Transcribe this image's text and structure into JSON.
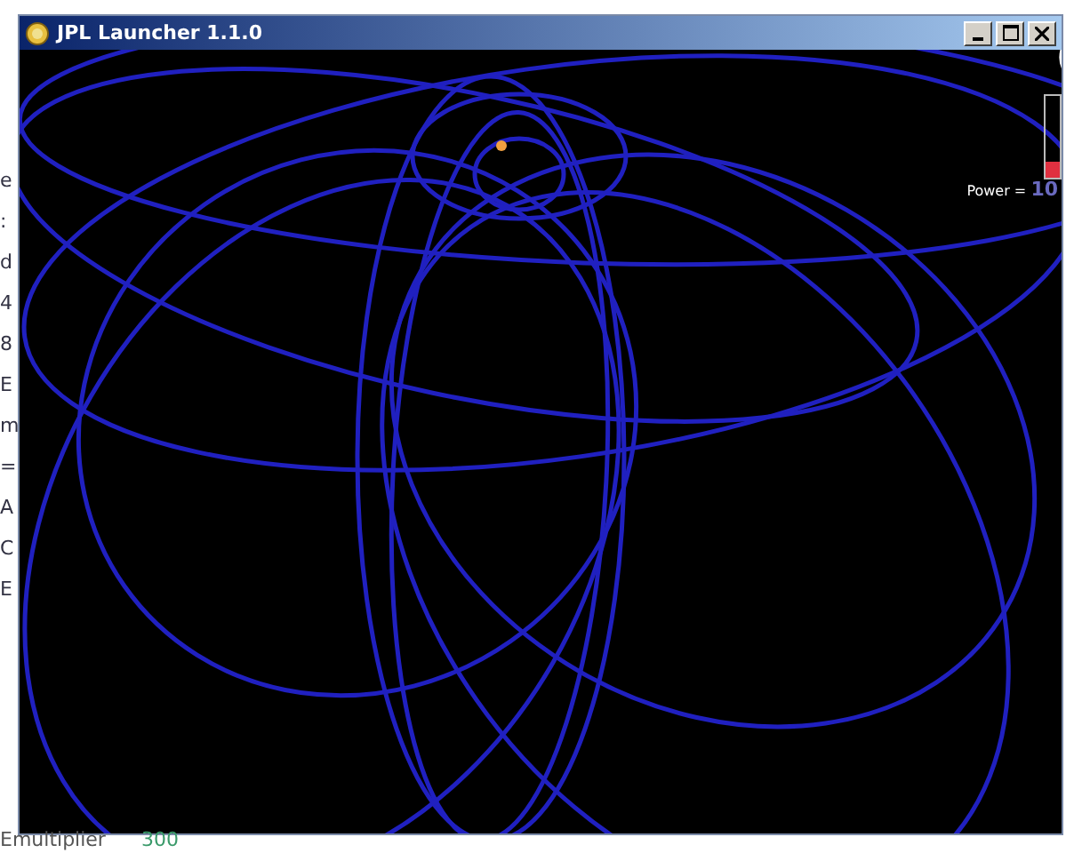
{
  "background_fragments": [
    "e",
    ":",
    "d",
    "4",
    "8",
    "E",
    "m",
    "=",
    "A",
    "C",
    "E"
  ],
  "background_field": {
    "label": "Emultiplier",
    "value": "300"
  },
  "window": {
    "title": "JPL Launcher 1.1.0"
  },
  "power": {
    "label": "Power = ",
    "value": "10",
    "level": 0.2
  }
}
